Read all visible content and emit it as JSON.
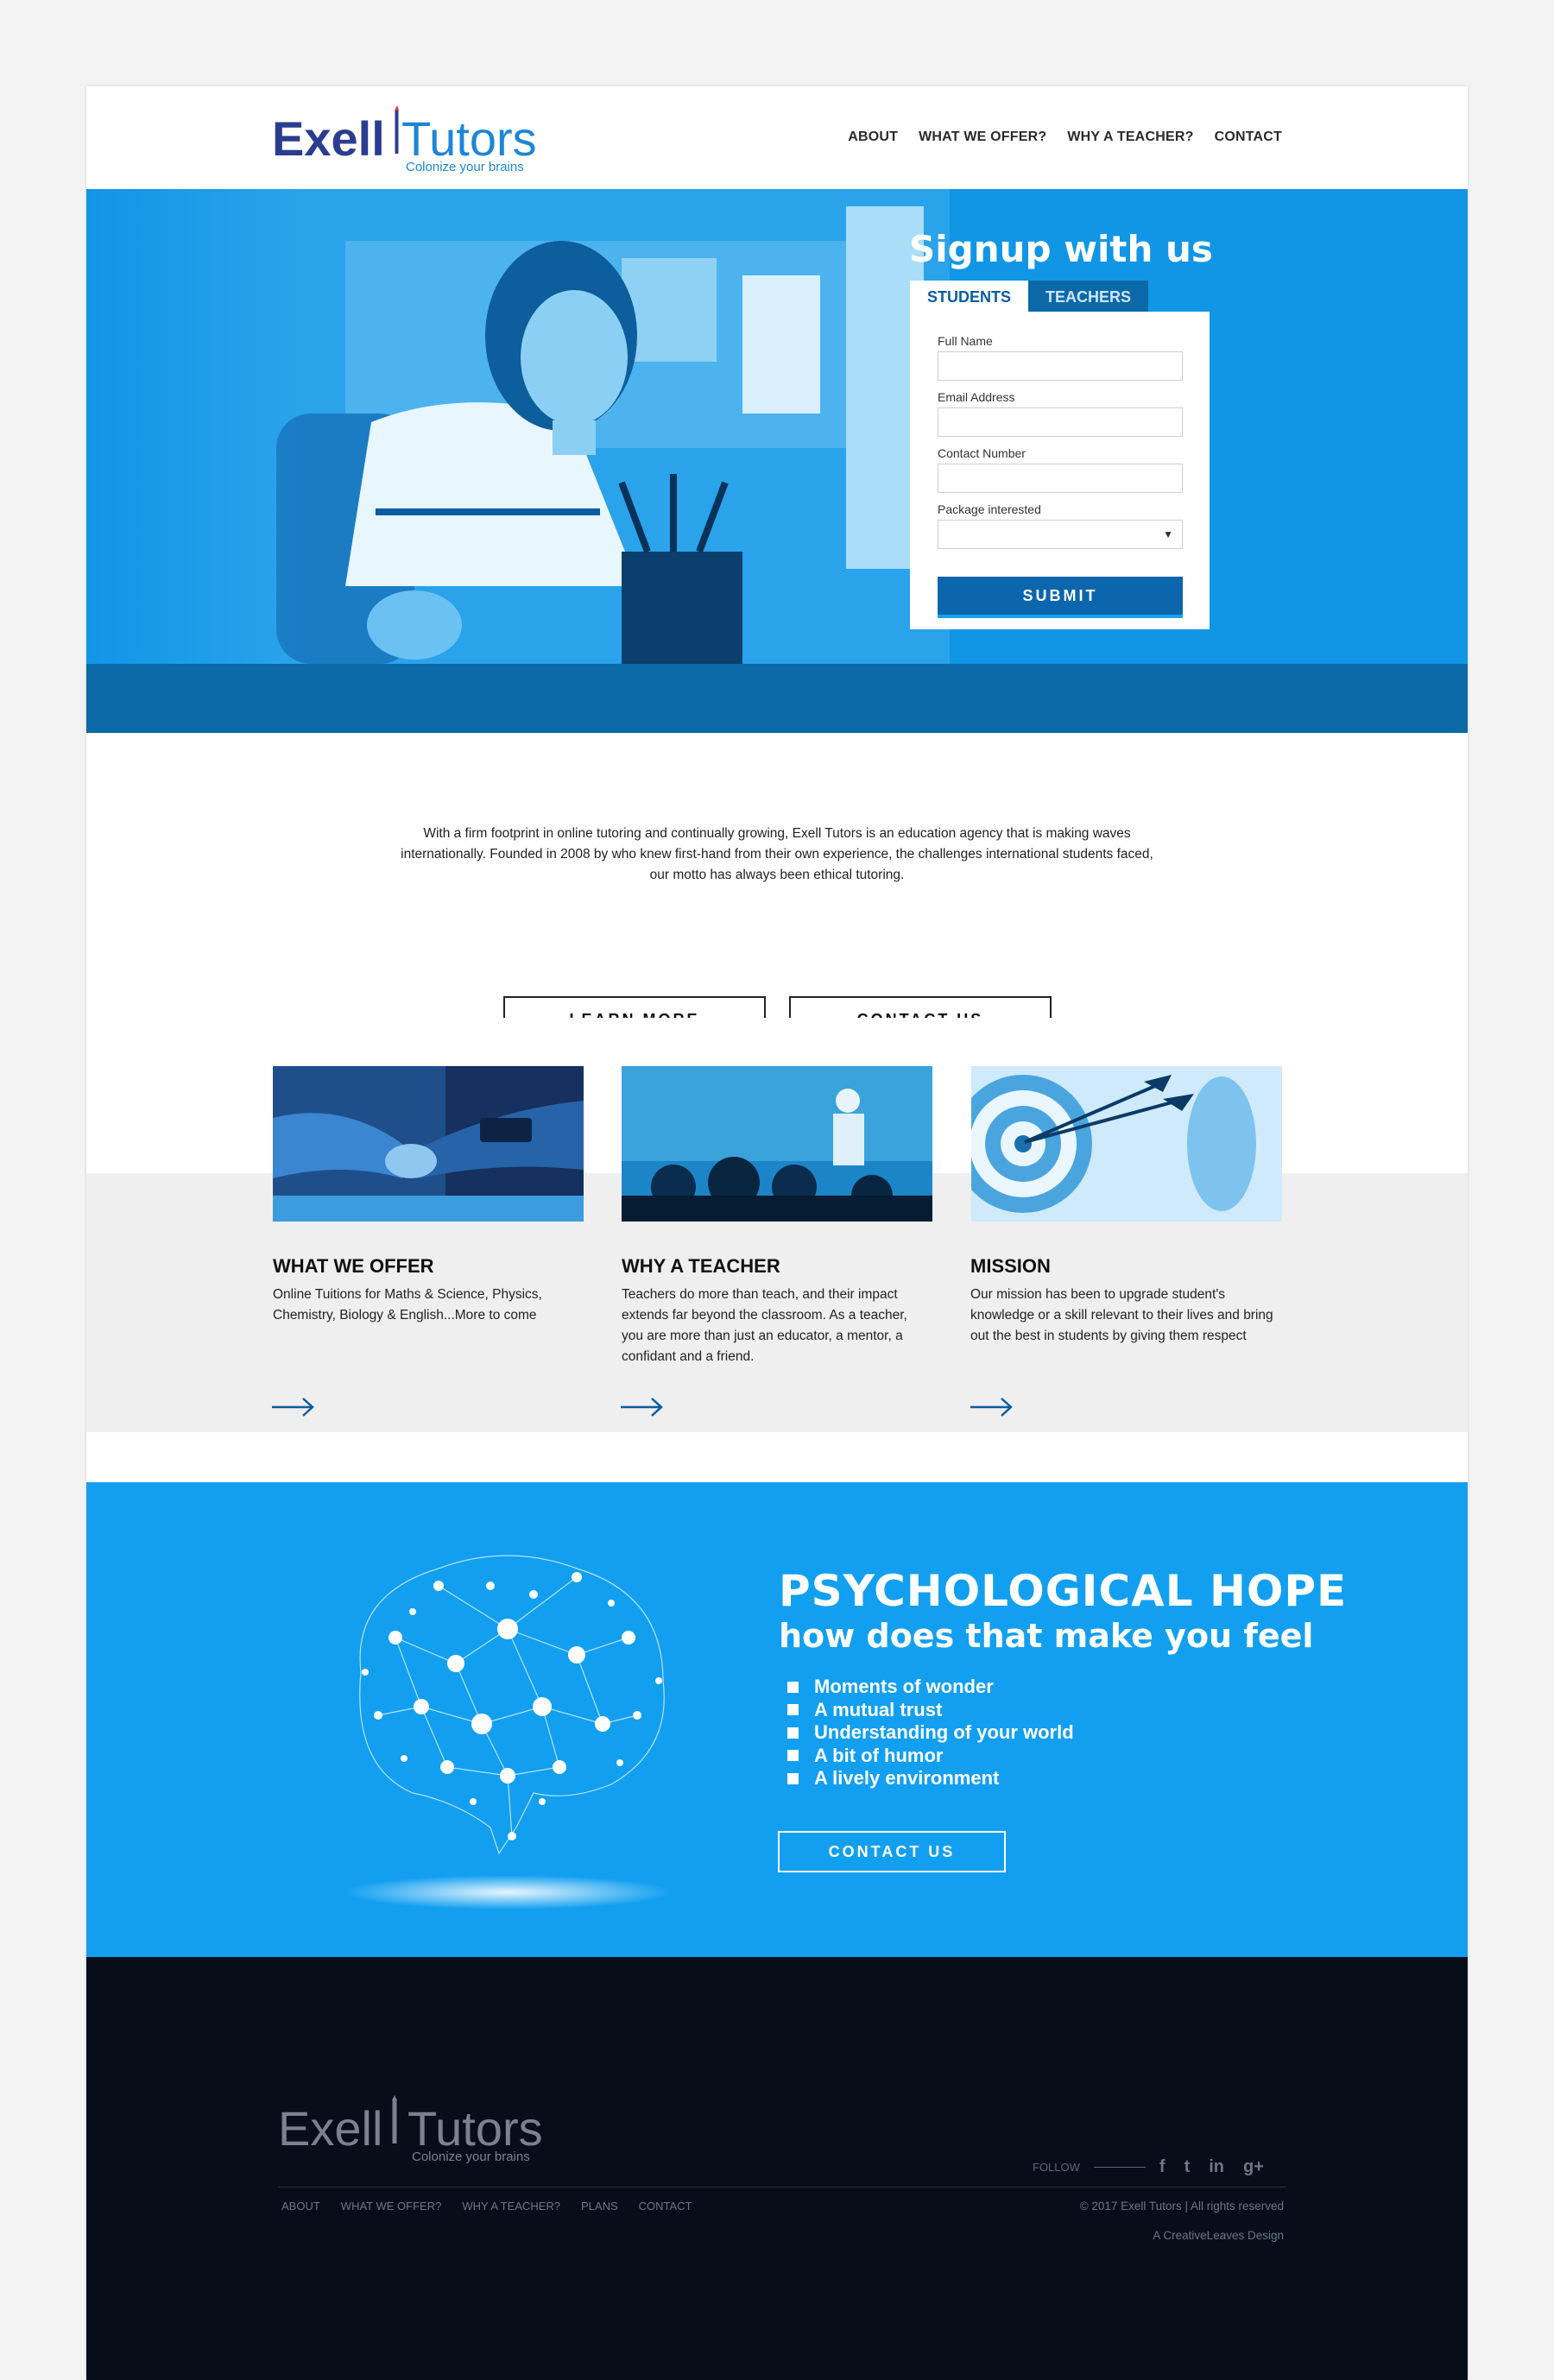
{
  "brand": {
    "name_part1": "Exell",
    "name_part2": "Tutors",
    "tagline": "Colonize your brains"
  },
  "nav": {
    "items": [
      "ABOUT",
      "WHAT WE OFFER?",
      "WHY A TEACHER?",
      "CONTACT"
    ]
  },
  "signup": {
    "title": "Signup with us",
    "tabs": [
      "STUDENTS",
      "TEACHERS"
    ],
    "active_tab": "STUDENTS",
    "fields": {
      "full_name": {
        "label": "Full Name",
        "value": ""
      },
      "email": {
        "label": "Email Address",
        "value": ""
      },
      "contact": {
        "label": "Contact Number",
        "value": ""
      },
      "package": {
        "label": "Package interested",
        "value": ""
      }
    },
    "submit_label": "SUBMIT"
  },
  "intro": {
    "text": "With a firm footprint in online tutoring and continually growing, Exell Tutors is an education agency that is making waves internationally. Founded in 2008 by who knew first-hand from their own experience, the challenges international students faced, our motto has always been ethical tutoring.",
    "learn_more": "LEARN MORE",
    "contact_us": "CONTACT US"
  },
  "features": [
    {
      "title": "WHAT WE OFFER",
      "text": "Online Tuitions for Maths & Science, Physics, Chemistry, Biology & English...More to come",
      "image": "handshake-photo"
    },
    {
      "title": "WHY A TEACHER",
      "text": "Teachers do more than teach, and their impact extends far beyond the classroom. As a teacher, you are more than just an educator, a mentor, a confidant and a friend.",
      "image": "classroom-photo"
    },
    {
      "title": "MISSION",
      "text": "Our mission has been to upgrade student's knowledge or a skill relevant to their lives and bring out the best in students by giving them respect",
      "image": "target-arrows-photo"
    }
  ],
  "psych": {
    "title": "PSYCHOLOGICAL HOPE",
    "subtitle": "how does that make you feel",
    "items": [
      "Moments of wonder",
      "A mutual trust",
      "Understanding of your world",
      "A bit of humor",
      "A lively environment"
    ],
    "button": "CONTACT US"
  },
  "footer": {
    "follow_label": "FOLLOW",
    "social": [
      "f",
      "t",
      "in",
      "g+"
    ],
    "nav": [
      "ABOUT",
      "WHAT WE OFFER?",
      "WHY A TEACHER?",
      "PLANS",
      "CONTACT"
    ],
    "copyright": "© 2017 Exell Tutors  |  All rights reserved",
    "credit": "A CreativeLeaves Design"
  },
  "colors": {
    "primary_blue": "#1196e6",
    "dark_blue": "#0b69a8",
    "navy": "#2a3d8f",
    "psych_blue": "#129ff0",
    "footer_bg": "#050e19"
  }
}
